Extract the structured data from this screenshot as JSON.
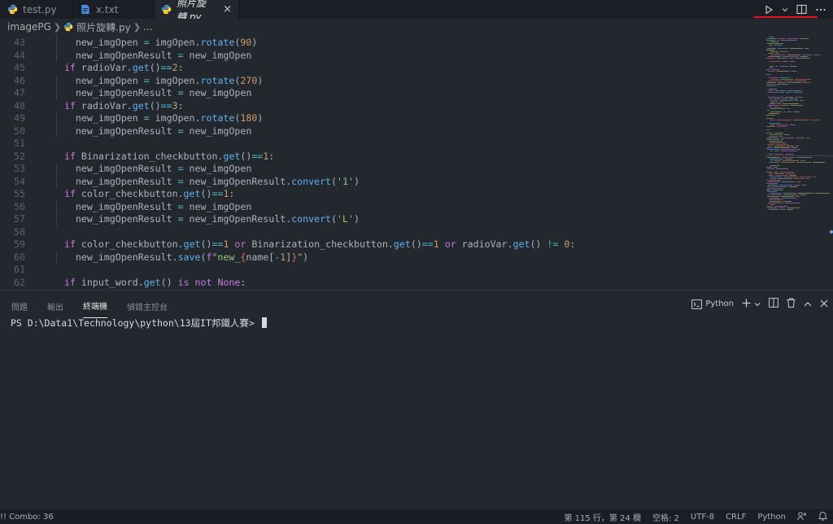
{
  "tabs": [
    {
      "label": "test.py",
      "icon": "python-file-icon"
    },
    {
      "label": "x.txt",
      "icon": "text-file-icon"
    },
    {
      "label": "照片旋轉.py",
      "icon": "python-file-icon",
      "active": true
    }
  ],
  "close_glyph": "×",
  "breadcrumb": {
    "folder": "imagePG",
    "file": "照片旋轉.py",
    "more": "..."
  },
  "code": [
    {
      "n": "43",
      "t": [
        [
          "pl",
          "    new_imgOpen "
        ],
        [
          "op",
          "="
        ],
        [
          "pl",
          " imgOpen."
        ],
        [
          "fn",
          "rotate"
        ],
        [
          "pl",
          "("
        ],
        [
          "num",
          "90"
        ],
        [
          "pl",
          ")"
        ]
      ]
    },
    {
      "n": "44",
      "t": [
        [
          "pl",
          "    new_imgOpenResult "
        ],
        [
          "op",
          "="
        ],
        [
          "pl",
          " new_imgOpen"
        ]
      ]
    },
    {
      "n": "45",
      "t": [
        [
          "kw",
          "  if"
        ],
        [
          "pl",
          " radioVar."
        ],
        [
          "fn",
          "get"
        ],
        [
          "pl",
          "()"
        ],
        [
          "op",
          "=="
        ],
        [
          "num",
          "2"
        ],
        [
          "pl",
          ":"
        ]
      ]
    },
    {
      "n": "46",
      "t": [
        [
          "pl",
          "    new_imgOpen "
        ],
        [
          "op",
          "="
        ],
        [
          "pl",
          " imgOpen."
        ],
        [
          "fn",
          "rotate"
        ],
        [
          "pl",
          "("
        ],
        [
          "num",
          "270"
        ],
        [
          "pl",
          ")"
        ]
      ]
    },
    {
      "n": "47",
      "t": [
        [
          "pl",
          "    new_imgOpenResult "
        ],
        [
          "op",
          "="
        ],
        [
          "pl",
          " new_imgOpen"
        ]
      ]
    },
    {
      "n": "48",
      "t": [
        [
          "kw",
          "  if"
        ],
        [
          "pl",
          " radioVar."
        ],
        [
          "fn",
          "get"
        ],
        [
          "pl",
          "()"
        ],
        [
          "op",
          "=="
        ],
        [
          "num",
          "3"
        ],
        [
          "pl",
          ":"
        ]
      ]
    },
    {
      "n": "49",
      "t": [
        [
          "pl",
          "    new_imgOpen "
        ],
        [
          "op",
          "="
        ],
        [
          "pl",
          " imgOpen."
        ],
        [
          "fn",
          "rotate"
        ],
        [
          "pl",
          "("
        ],
        [
          "num",
          "180"
        ],
        [
          "pl",
          ")"
        ]
      ]
    },
    {
      "n": "50",
      "t": [
        [
          "pl",
          "    new_imgOpenResult "
        ],
        [
          "op",
          "="
        ],
        [
          "pl",
          " new_imgOpen"
        ]
      ]
    },
    {
      "n": "51",
      "t": []
    },
    {
      "n": "52",
      "t": [
        [
          "kw",
          "  if"
        ],
        [
          "pl",
          " Binarization_checkbutton."
        ],
        [
          "fn",
          "get"
        ],
        [
          "pl",
          "()"
        ],
        [
          "op",
          "=="
        ],
        [
          "num",
          "1"
        ],
        [
          "pl",
          ":"
        ]
      ]
    },
    {
      "n": "53",
      "t": [
        [
          "pl",
          "    new_imgOpenResult "
        ],
        [
          "op",
          "="
        ],
        [
          "pl",
          " new_imgOpen"
        ]
      ]
    },
    {
      "n": "54",
      "t": [
        [
          "pl",
          "    new_imgOpenResult "
        ],
        [
          "op",
          "="
        ],
        [
          "pl",
          " new_imgOpenResult."
        ],
        [
          "fn",
          "convert"
        ],
        [
          "pl",
          "("
        ],
        [
          "str",
          "'1'"
        ],
        [
          "pl",
          ")"
        ]
      ]
    },
    {
      "n": "55",
      "t": [
        [
          "kw",
          "  if"
        ],
        [
          "pl",
          " color_checkbutton."
        ],
        [
          "fn",
          "get"
        ],
        [
          "pl",
          "()"
        ],
        [
          "op",
          "=="
        ],
        [
          "num",
          "1"
        ],
        [
          "pl",
          ":"
        ]
      ]
    },
    {
      "n": "56",
      "t": [
        [
          "pl",
          "    new_imgOpenResult "
        ],
        [
          "op",
          "="
        ],
        [
          "pl",
          " new_imgOpen"
        ]
      ]
    },
    {
      "n": "57",
      "t": [
        [
          "pl",
          "    new_imgOpenResult "
        ],
        [
          "op",
          "="
        ],
        [
          "pl",
          " new_imgOpenResult."
        ],
        [
          "fn",
          "convert"
        ],
        [
          "pl",
          "("
        ],
        [
          "str",
          "'L'"
        ],
        [
          "pl",
          ")"
        ]
      ]
    },
    {
      "n": "58",
      "t": []
    },
    {
      "n": "59",
      "t": [
        [
          "kw",
          "  if"
        ],
        [
          "pl",
          " color_checkbutton."
        ],
        [
          "fn",
          "get"
        ],
        [
          "pl",
          "()"
        ],
        [
          "op",
          "=="
        ],
        [
          "num",
          "1"
        ],
        [
          "kw",
          " or"
        ],
        [
          "pl",
          " Binarization_checkbutton."
        ],
        [
          "fn",
          "get"
        ],
        [
          "pl",
          "()"
        ],
        [
          "op",
          "=="
        ],
        [
          "num",
          "1"
        ],
        [
          "kw",
          " or"
        ],
        [
          "pl",
          " radioVar."
        ],
        [
          "fn",
          "get"
        ],
        [
          "pl",
          "() "
        ],
        [
          "op",
          "!="
        ],
        [
          "num",
          " 0"
        ],
        [
          "pl",
          ":"
        ]
      ]
    },
    {
      "n": "60",
      "t": [
        [
          "pl",
          "    new_imgOpenResult."
        ],
        [
          "fn",
          "save"
        ],
        [
          "pl",
          "("
        ],
        [
          "kw",
          "f"
        ],
        [
          "str",
          "\"new_"
        ],
        [
          "cls",
          "{"
        ],
        [
          "pl",
          "name["
        ],
        [
          "op",
          "-"
        ],
        [
          "num",
          "1"
        ],
        [
          "pl",
          "]"
        ],
        [
          "cls",
          "}"
        ],
        [
          "str",
          "\""
        ],
        [
          "pl",
          ")"
        ]
      ]
    },
    {
      "n": "61",
      "t": []
    },
    {
      "n": "62",
      "t": [
        [
          "kw",
          "  if"
        ],
        [
          "pl",
          " input_word."
        ],
        [
          "fn",
          "get"
        ],
        [
          "pl",
          "() "
        ],
        [
          "kw",
          "is not"
        ],
        [
          "kw",
          " None"
        ],
        [
          "pl",
          ":"
        ]
      ]
    }
  ],
  "panel": {
    "tabs": [
      "問題",
      "輸出",
      "終端機",
      "偵錯主控台"
    ],
    "active_tab": 2,
    "shell_label": "Python",
    "terminal_prompt": "PS D:\\Data1\\Technology\\python\\13屆IT邦鐵人賽> "
  },
  "status": {
    "left": "!! Combo: 36",
    "position": "第 115 行，第 24 欄",
    "spaces": "空格: 2",
    "encoding": "UTF-8",
    "eol": "CRLF",
    "language": "Python"
  },
  "colors": {
    "accent_red": "#e0151b",
    "editor_bg": "#23272e"
  }
}
